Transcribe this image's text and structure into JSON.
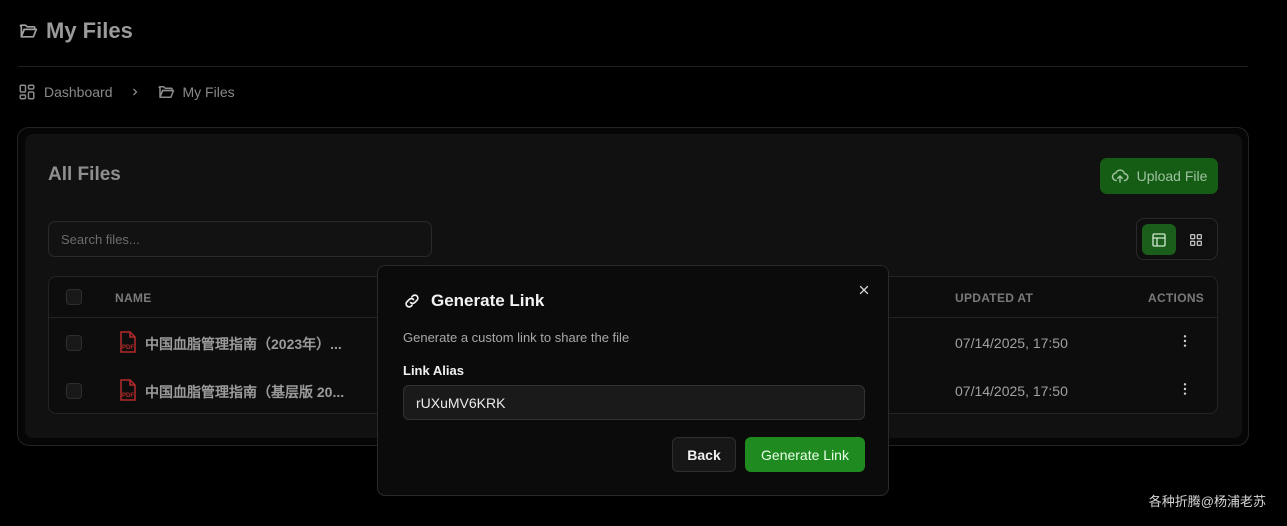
{
  "page": {
    "title": "My Files"
  },
  "breadcrumb": {
    "items": [
      "Dashboard",
      "My Files"
    ]
  },
  "card": {
    "title": "All Files",
    "upload_label": "Upload File",
    "search_placeholder": "Search files..."
  },
  "table": {
    "columns": {
      "name": "NAME",
      "updated_at": "UPDATED AT",
      "actions": "ACTIONS"
    },
    "rows": [
      {
        "name": "中国血脂管理指南（2023年）...",
        "updated_at": "07/14/2025, 17:50"
      },
      {
        "name": "中国血脂管理指南（基层版 20...",
        "updated_at": "07/14/2025, 17:50"
      }
    ]
  },
  "modal": {
    "title": "Generate Link",
    "description": "Generate a custom link to share the file",
    "field_label": "Link Alias",
    "field_value": "rUXuMV6KRK",
    "back_label": "Back",
    "generate_label": "Generate Link"
  },
  "watermark": "各种折腾@杨浦老苏",
  "colors": {
    "accent": "#1f8a1f",
    "accent_dark": "#155d15",
    "pdf_red": "#b32b2b"
  }
}
